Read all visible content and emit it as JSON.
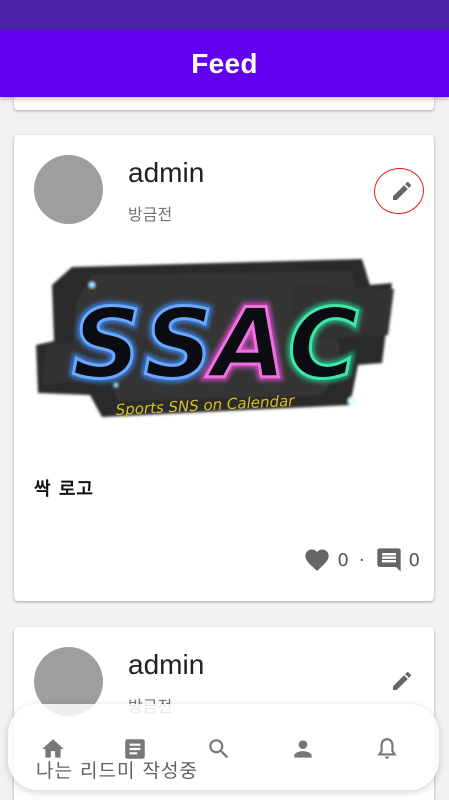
{
  "app": {
    "title": "Feed",
    "accent": "#6200ee",
    "status_bar_color": "#4a22a8"
  },
  "posts": [
    {
      "author": "admin",
      "time": "방금전",
      "image": {
        "text": "SSAC",
        "subtitle": "Sports SNS on Calendar"
      },
      "text": "싹 로고",
      "likes": "0",
      "separator": "·",
      "comments": "0",
      "edit_icon": "pencil-icon",
      "annotation_color": "#e0201c"
    },
    {
      "author": "admin",
      "time": "방금전",
      "edit_icon": "pencil-icon"
    }
  ],
  "bottom_nav": {
    "items": [
      {
        "icon": "home-icon"
      },
      {
        "icon": "document-icon"
      },
      {
        "icon": "search-icon"
      },
      {
        "icon": "person-icon"
      },
      {
        "icon": "bell-icon"
      }
    ],
    "draft_text": "나는 리드미 작성중"
  }
}
